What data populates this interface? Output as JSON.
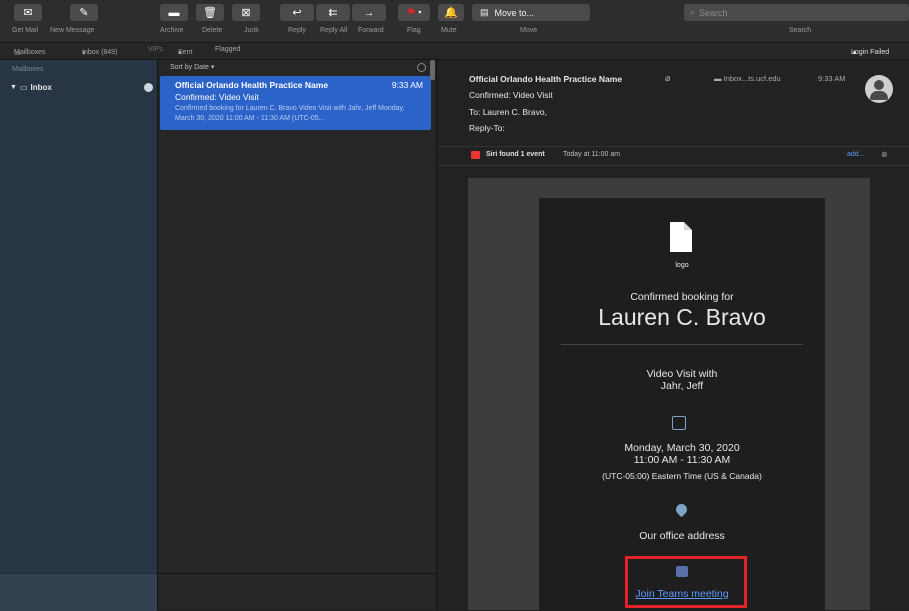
{
  "toolbar": {
    "get_mail": "Get Mail",
    "new_message": "New Message",
    "archive": "Archive",
    "delete": "Delete",
    "junk": "Junk",
    "reply": "Reply",
    "reply_all": "Reply All",
    "forward": "Forward",
    "flag": "Flag",
    "mute": "Mute",
    "move_to": "Move to...",
    "move": "Move",
    "search_placeholder": "Search",
    "search_label": "Search"
  },
  "favbar": {
    "mailboxes": "Mailboxes",
    "inbox": "Inbox (849)",
    "vips": "VIPs",
    "sent": "Sent",
    "flagged": "Flagged",
    "login_failed": "Login Failed"
  },
  "sidebar": {
    "header": "Mailboxes",
    "inbox_label": "Inbox"
  },
  "message_list": {
    "sort_label": "Sort by Date",
    "messages": [
      {
        "from": "Official Orlando Health Practice Name",
        "time": "9:33 AM",
        "subject": "Confirmed: Video Visit",
        "preview": "Confirmed booking for Lauren C. Bravo Video Visit with Jahr, Jeff Monday, March 30, 2020 11:00 AM - 11:30 AM (UTC-05..."
      }
    ]
  },
  "reader": {
    "from": "Official Orlando Health Practice Name",
    "mailbox": "Inbox...ts.ucf.edu",
    "time": "9:33 AM",
    "subject": "Confirmed: Video Visit",
    "to": "To:  Lauren C. Bravo,",
    "reply_to": "Reply-To:",
    "siri_found": "Siri found 1 event",
    "siri_when": "Today at 11:00 am",
    "siri_add": "add..."
  },
  "email": {
    "logo": "logo",
    "confirmed_for": "Confirmed booking for",
    "name": "Lauren C. Bravo",
    "visit_line1": "Video Visit with",
    "visit_line2": "Jahr, Jeff",
    "date": "Monday, March 30, 2020",
    "time": "11:00 AM - 11:30 AM",
    "timezone": "(UTC-05:00) Eastern Time (US & Canada)",
    "address": "Our office address",
    "teams_link": "Join Teams meeting"
  },
  "colors": {
    "selection": "#2c63c9",
    "highlight_box": "#e3222b",
    "link": "#5b9bff",
    "sidebar": "#283544"
  }
}
